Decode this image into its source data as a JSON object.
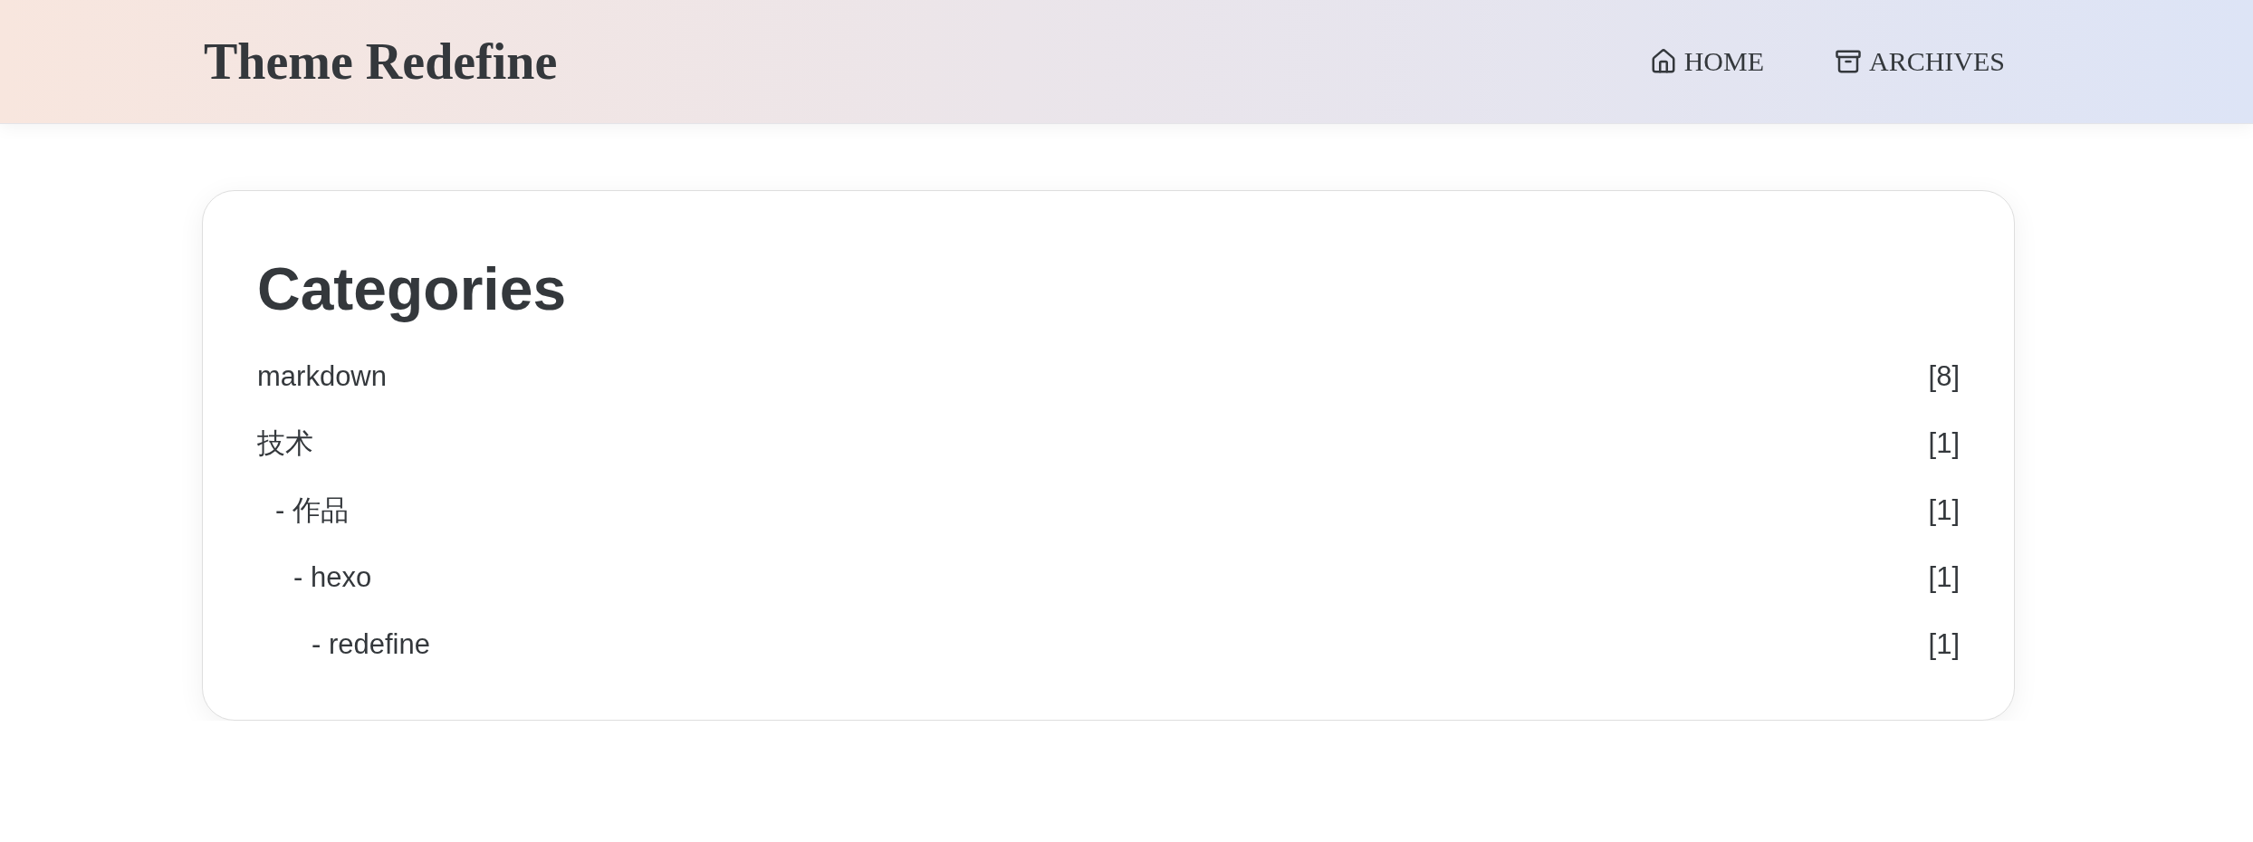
{
  "header": {
    "title": "Theme Redefine",
    "nav": [
      {
        "kind": "home",
        "label": "HOME"
      },
      {
        "kind": "archive",
        "label": "ARCHIVES"
      }
    ]
  },
  "card": {
    "title": "Categories",
    "categories": [
      {
        "name": "markdown",
        "count": "[8]"
      },
      {
        "name": "技术",
        "count": "[1]",
        "children": [
          {
            "name": "- 作品",
            "count": "[1]",
            "children": [
              {
                "name": "- hexo",
                "count": "[1]",
                "children": [
                  {
                    "name": "- redefine",
                    "count": "[1]"
                  }
                ]
              }
            ]
          }
        ]
      }
    ]
  }
}
